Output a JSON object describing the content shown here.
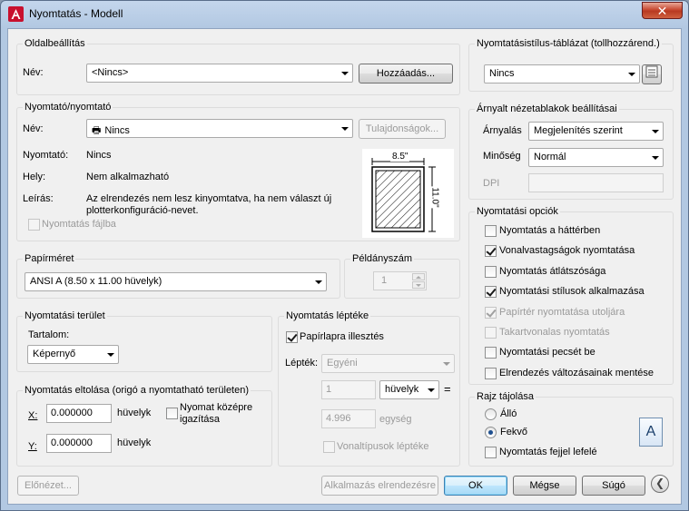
{
  "window": {
    "title": "Nyomtatás - Modell",
    "close_label": "✕"
  },
  "page_setup": {
    "group_label": "Oldalbeállítás",
    "name_label": "Név:",
    "name_value": "<Nincs>",
    "add_button": "Hozzáadás..."
  },
  "printer": {
    "group_label": "Nyomtató/nyomtató",
    "name_label": "Név:",
    "name_value": "Nincs",
    "properties_button": "Tulajdonságok...",
    "plotter_label": "Nyomtató:",
    "plotter_value": "Nincs",
    "where_label": "Hely:",
    "where_value": "Nem alkalmazható",
    "description_label": "Leírás:",
    "description_line1": "Az elrendezés nem lesz kinyomtatva, ha nem választ új",
    "description_line2": "plotterkonfiguráció-nevet.",
    "plot_to_file_label": "Nyomtatás fájlba",
    "preview_width_label": "8.5\"",
    "preview_height_label": "11.0\""
  },
  "paper_size": {
    "group_label": "Papírméret",
    "value": "ANSI A (8.50 x 11.00 hüvelyk)"
  },
  "copies": {
    "group_label": "Példányszám",
    "value": "1"
  },
  "plot_area": {
    "group_label": "Nyomtatási terület",
    "what_label": "Tartalom:",
    "what_value": "Képernyő"
  },
  "plot_offset": {
    "group_label": "Nyomtatás eltolása (origó a nyomtatható területen)",
    "x_label": "X:",
    "x_value": "0.000000",
    "x_unit": "hüvelyk",
    "y_label": "Y:",
    "y_value": "0.000000",
    "y_unit": "hüvelyk",
    "center_label_line1": "Nyomat középre",
    "center_label_line2": "igazítása"
  },
  "plot_scale": {
    "group_label": "Nyomtatás léptéke",
    "fit_label": "Papírlapra illesztés",
    "scale_label": "Lépték:",
    "scale_value": "Egyéni",
    "value1": "1",
    "unit_value": "hüvelyk",
    "equals": "=",
    "value2": "4.996",
    "unit2": "egység",
    "lineweights_label": "Vonaltípusok léptéke"
  },
  "plot_style_table": {
    "group_label": "Nyomtatásistílus-táblázat (tollhozzárend.)",
    "value": "Nincs"
  },
  "shaded_viewport": {
    "group_label": "Árnyalt nézetablakok beállításai",
    "shade_label": "Árnyalás",
    "shade_value": "Megjelenítés szerint",
    "quality_label": "Minőség",
    "quality_value": "Normál",
    "dpi_label": "DPI"
  },
  "plot_options": {
    "group_label": "Nyomtatási opciók",
    "items": [
      {
        "label": "Nyomtatás a háttérben",
        "checked": false,
        "disabled": false
      },
      {
        "label": "Vonalvastagságok nyomtatása",
        "checked": true,
        "disabled": false
      },
      {
        "label": "Nyomtatás átlátszósága",
        "checked": false,
        "disabled": false
      },
      {
        "label": "Nyomtatási stílusok alkalmazása",
        "checked": true,
        "disabled": false
      },
      {
        "label": "Papírtér nyomtatása utoljára",
        "checked": true,
        "disabled": true
      },
      {
        "label": "Takartvonalas nyomtatás",
        "checked": false,
        "disabled": true
      },
      {
        "label": "Nyomtatási pecsét be",
        "checked": false,
        "disabled": false
      },
      {
        "label": "Elrendezés változásainak mentése",
        "checked": false,
        "disabled": false
      }
    ]
  },
  "orientation": {
    "group_label": "Rajz tájolása",
    "portrait_label": "Álló",
    "landscape_label": "Fekvő",
    "upside_down_label": "Nyomtatás fejjel lefelé",
    "icon_letter": "A"
  },
  "footer": {
    "preview_button": "Előnézet...",
    "apply_button": "Alkalmazás elrendezésre",
    "ok_button": "OK",
    "cancel_button": "Mégse",
    "help_button": "Súgó",
    "more_icon": "❮"
  }
}
